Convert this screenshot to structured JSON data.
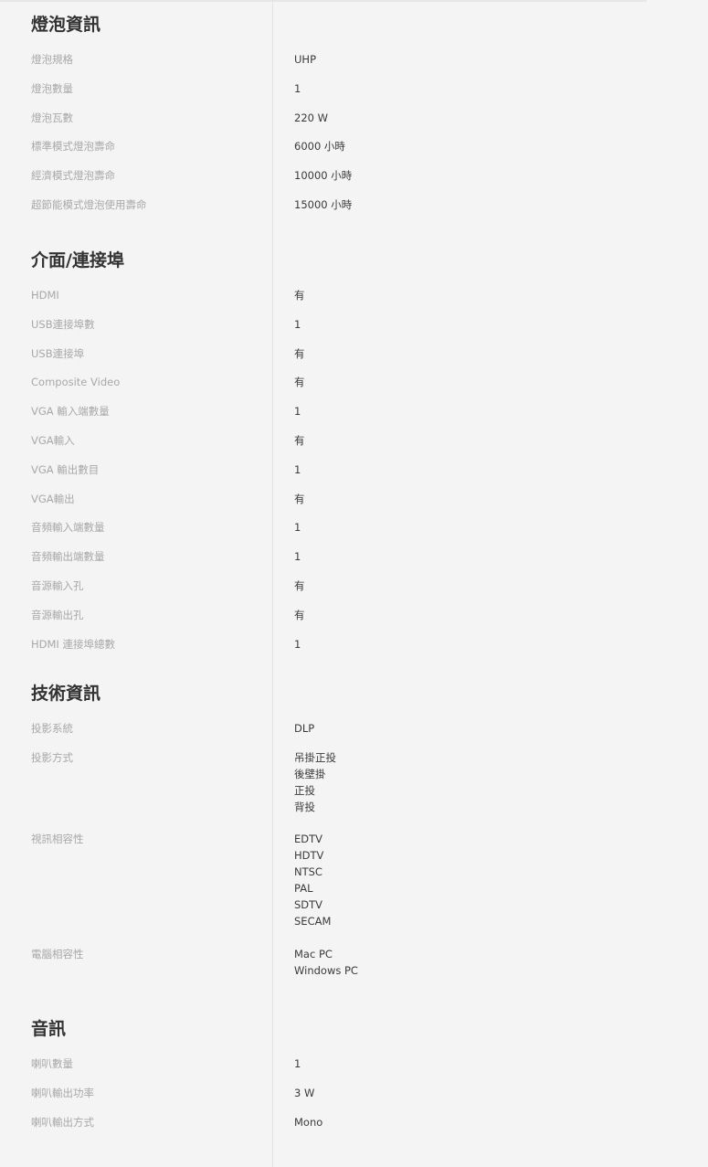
{
  "sections": [
    {
      "title": "燈泡資訊",
      "rows": [
        {
          "label": "燈泡規格",
          "values": [
            "UHP"
          ]
        },
        {
          "label": "燈泡數量",
          "values": [
            "1"
          ]
        },
        {
          "label": "燈泡瓦數",
          "values": [
            "220 W"
          ]
        },
        {
          "label": "標準模式燈泡壽命",
          "values": [
            "6000 小時"
          ]
        },
        {
          "label": "經濟模式燈泡壽命",
          "values": [
            "10000 小時"
          ]
        },
        {
          "label": "超節能模式燈泡使用壽命",
          "values": [
            "15000 小時"
          ]
        }
      ]
    },
    {
      "title": "介面/連接埠",
      "rows": [
        {
          "label": "HDMI",
          "values": [
            "有"
          ]
        },
        {
          "label": "USB連接埠數",
          "values": [
            "1"
          ]
        },
        {
          "label": "USB連接埠",
          "values": [
            "有"
          ]
        },
        {
          "label": "Composite Video",
          "values": [
            "有"
          ]
        },
        {
          "label": "VGA 輸入端數量",
          "values": [
            "1"
          ]
        },
        {
          "label": "VGA輸入",
          "values": [
            "有"
          ]
        },
        {
          "label": "VGA 輸出數目",
          "values": [
            "1"
          ]
        },
        {
          "label": "VGA輸出",
          "values": [
            "有"
          ]
        },
        {
          "label": "音頻輸入端數量",
          "values": [
            "1"
          ]
        },
        {
          "label": "音頻輸出端數量",
          "values": [
            "1"
          ]
        },
        {
          "label": "音源輸入孔",
          "values": [
            "有"
          ]
        },
        {
          "label": "音源輸出孔",
          "values": [
            "有"
          ]
        },
        {
          "label": "HDMI 連接埠總數",
          "values": [
            "1"
          ]
        }
      ]
    },
    {
      "title": "技術資訊",
      "rows": [
        {
          "label": "投影系統",
          "values": [
            "DLP"
          ]
        },
        {
          "label": "投影方式",
          "values": [
            "吊掛正投",
            "後壁掛",
            "正投",
            "背投"
          ]
        },
        {
          "label": "視訊相容性",
          "values": [
            "EDTV",
            "HDTV",
            "NTSC",
            "PAL",
            "SDTV",
            "SECAM"
          ]
        },
        {
          "label": "電腦相容性",
          "values": [
            "Mac PC",
            "Windows PC"
          ]
        }
      ]
    },
    {
      "title": "音訊",
      "rows": [
        {
          "label": "喇叭數量",
          "values": [
            "1"
          ]
        },
        {
          "label": "喇叭輸出功率",
          "values": [
            "3 W"
          ]
        },
        {
          "label": "喇叭輸出方式",
          "values": [
            "Mono"
          ]
        }
      ]
    }
  ]
}
